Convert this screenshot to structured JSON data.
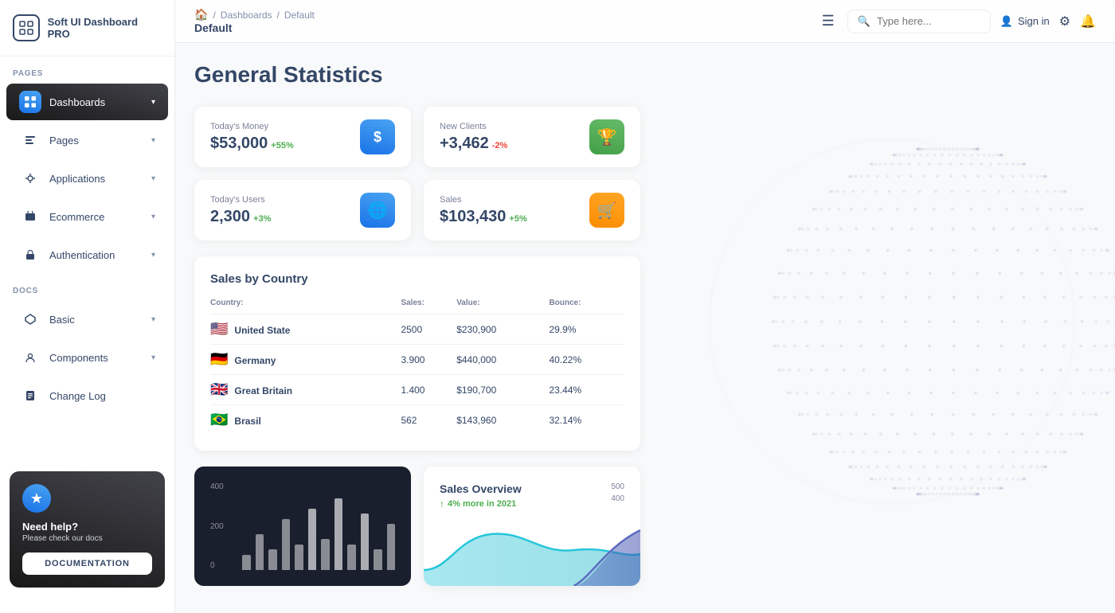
{
  "logo": {
    "icon": "⊞",
    "text": "Soft UI Dashboard PRO"
  },
  "sidebar": {
    "pages_label": "PAGES",
    "docs_label": "DOCS",
    "items_pages": [
      {
        "id": "dashboards",
        "label": "Dashboards",
        "icon": "⊟",
        "active": true,
        "arrow": "▾"
      },
      {
        "id": "pages",
        "label": "Pages",
        "icon": "📊",
        "active": false,
        "arrow": "▾"
      },
      {
        "id": "applications",
        "label": "Applications",
        "icon": "🔧",
        "active": false,
        "arrow": "▾"
      },
      {
        "id": "ecommerce",
        "label": "Ecommerce",
        "icon": "🏪",
        "active": false,
        "arrow": "▾"
      },
      {
        "id": "authentication",
        "label": "Authentication",
        "icon": "📄",
        "active": false,
        "arrow": "▾"
      }
    ],
    "items_docs": [
      {
        "id": "basic",
        "label": "Basic",
        "icon": "🚀",
        "active": false,
        "arrow": "▾"
      },
      {
        "id": "components",
        "label": "Components",
        "icon": "👤",
        "active": false,
        "arrow": "▾"
      },
      {
        "id": "changelog",
        "label": "Change Log",
        "icon": "📋",
        "active": false
      }
    ]
  },
  "need_help": {
    "star": "★",
    "title": "Need help?",
    "subtitle": "Please check our docs",
    "button_label": "DOCUMENTATION"
  },
  "topnav": {
    "breadcrumb_home": "🏠",
    "breadcrumb_sep1": "/",
    "breadcrumb_dashboards": "Dashboards",
    "breadcrumb_sep2": "/",
    "breadcrumb_current": "Default",
    "page_subtitle": "Default",
    "hamburger": "☰",
    "search_placeholder": "Type here...",
    "signin_label": "Sign in",
    "settings_icon": "⚙",
    "bell_icon": "🔔"
  },
  "main": {
    "page_title": "General Statistics",
    "stats": [
      {
        "label": "Today's Money",
        "value": "$53,000",
        "change": "+55%",
        "change_type": "pos",
        "icon": "$",
        "icon_color": "blue2"
      },
      {
        "label": "New Clients",
        "value": "+3,462",
        "change": "-2%",
        "change_type": "neg",
        "icon": "🏆",
        "icon_color": "green"
      },
      {
        "label": "Today's Users",
        "value": "2,300",
        "change": "+3%",
        "change_type": "pos",
        "icon": "🌐",
        "icon_color": "blue2"
      },
      {
        "label": "Sales",
        "value": "$103,430",
        "change": "+5%",
        "change_type": "pos",
        "icon": "🛒",
        "icon_color": "orange"
      }
    ],
    "sales_by_country": {
      "title": "Sales by Country",
      "columns": [
        "Country:",
        "Sales:",
        "Value:",
        "Bounce:"
      ],
      "rows": [
        {
          "flag": "us",
          "flag_emoji": "🇺🇸",
          "country": "United State",
          "sales": "2500",
          "value": "$230,900",
          "bounce": "29.9%"
        },
        {
          "flag": "de",
          "flag_emoji": "🇩🇪",
          "country": "Germany",
          "sales": "3.900",
          "value": "$440,000",
          "bounce": "40.22%"
        },
        {
          "flag": "gb",
          "flag_emoji": "🇬🇧",
          "country": "Great Britain",
          "sales": "1.400",
          "value": "$190,700",
          "bounce": "23.44%"
        },
        {
          "flag": "br",
          "flag_emoji": "🇧🇷",
          "country": "Brasil",
          "sales": "562",
          "value": "$143,960",
          "bounce": "32.14%"
        }
      ]
    },
    "bar_chart": {
      "y_labels": [
        "400",
        "200",
        "0"
      ],
      "bars": [
        15,
        35,
        20,
        50,
        25,
        60,
        30,
        70,
        25,
        55,
        20,
        45
      ]
    },
    "sales_overview": {
      "title": "Sales Overview",
      "trend": "↑ 4% more in 2021",
      "y_labels": [
        "500",
        "400"
      ]
    }
  }
}
